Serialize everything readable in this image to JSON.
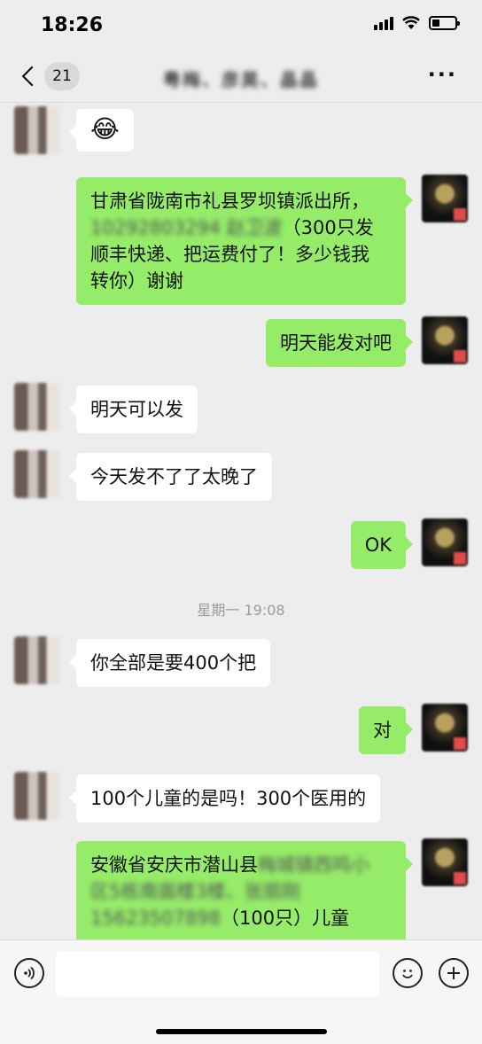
{
  "status_bar": {
    "time": "18:26",
    "battery_level": 0.35
  },
  "header": {
    "back_count": "21",
    "title": "粤梅、彦昊、晶晶",
    "more_label": "···"
  },
  "messages": [
    {
      "side": "left",
      "emoji": "😂"
    },
    {
      "side": "right",
      "line1": "甘肃省陇南市礼县罗坝镇派出所，",
      "line2_blur": "10292803294 赵卫波",
      "line2_text": "（300只发",
      "line3": "顺丰快递、把运费付了！多少钱我",
      "line4": "转你）谢谢"
    },
    {
      "side": "right",
      "text": "明天能发对吧"
    },
    {
      "side": "left",
      "text": "明天可以发"
    },
    {
      "side": "left",
      "text": "今天发不了了太晚了"
    },
    {
      "side": "right",
      "text": "OK"
    },
    {
      "side": "left",
      "text": "你全部是要400个把"
    },
    {
      "side": "right",
      "text": "对"
    },
    {
      "side": "left",
      "text": "100个儿童的是吗！300个医用的"
    },
    {
      "side": "right",
      "line1_text": "安徽省安庆市潜山县",
      "line1_blur": "梅城镇西鸣小",
      "line2_blur": "区5栋南面楼3楼、张丽刚",
      "line3_blur": "15623507898",
      "line3_text": "（100只）儿童"
    }
  ],
  "timestamp": "星期一 19:08",
  "input": {
    "value": ""
  },
  "icons": {
    "voice": "voice-icon",
    "emoji": "emoji-icon",
    "plus": "plus-icon"
  }
}
